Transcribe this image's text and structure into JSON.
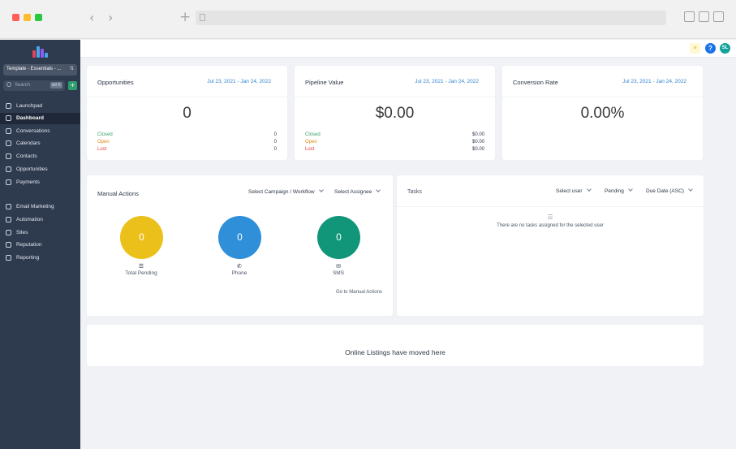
{
  "sidebar": {
    "account": "Template - Essentials - ...",
    "search_placeholder": "Search",
    "search_shortcut": "ctrl K",
    "items": [
      {
        "label": "Launchpad"
      },
      {
        "label": "Dashboard"
      },
      {
        "label": "Conversations"
      },
      {
        "label": "Calendars"
      },
      {
        "label": "Contacts"
      },
      {
        "label": "Opportunities"
      },
      {
        "label": "Payments"
      },
      {
        "label": "Email Marketing"
      },
      {
        "label": "Automation"
      },
      {
        "label": "Sites"
      },
      {
        "label": "Reputation"
      },
      {
        "label": "Reporting"
      }
    ]
  },
  "topbar": {
    "avatar_initials": "SL",
    "help_label": "?"
  },
  "stats": [
    {
      "title": "Opportunities",
      "date_range": "Jul 23, 2021 - Jan 24, 2022",
      "value": "0",
      "rows": [
        {
          "label": "Closed",
          "value": "0"
        },
        {
          "label": "Open",
          "value": "0"
        },
        {
          "label": "Lost",
          "value": "0"
        }
      ]
    },
    {
      "title": "Pipeline Value",
      "date_range": "Jul 23, 2021 - Jan 24, 2022",
      "value": "$0.00",
      "rows": [
        {
          "label": "Closed",
          "value": "$0.00"
        },
        {
          "label": "Open",
          "value": "$0.00"
        },
        {
          "label": "Lost",
          "value": "$0.00"
        }
      ]
    },
    {
      "title": "Conversion Rate",
      "date_range": "Jul 23, 2021 - Jan 24, 2022",
      "value": "0.00%"
    }
  ],
  "manual_actions": {
    "title": "Manual Actions",
    "campaign_select": "Select Campaign / Workflow",
    "assignee_select": "Select Assignee",
    "total_pending": {
      "value": "0",
      "label": "Total Pending"
    },
    "phone": {
      "value": "0",
      "label": "Phone"
    },
    "sms": {
      "value": "0",
      "label": "SMS"
    },
    "link": "Go to Manual Actions"
  },
  "tasks": {
    "title": "Tasks",
    "user_select": "Select user",
    "status_select": "Pending",
    "sort_select": "Due Date (ASC)",
    "empty_message": "There are no tasks assigned for the selected user"
  },
  "listings": {
    "message": "Online Listings have moved here"
  },
  "colors": {
    "sidebar_bg": "#2e3a4e",
    "pending": "#ecc01a",
    "phone": "#2f8fd9",
    "sms": "#11967a",
    "accent": "#3182ce"
  }
}
